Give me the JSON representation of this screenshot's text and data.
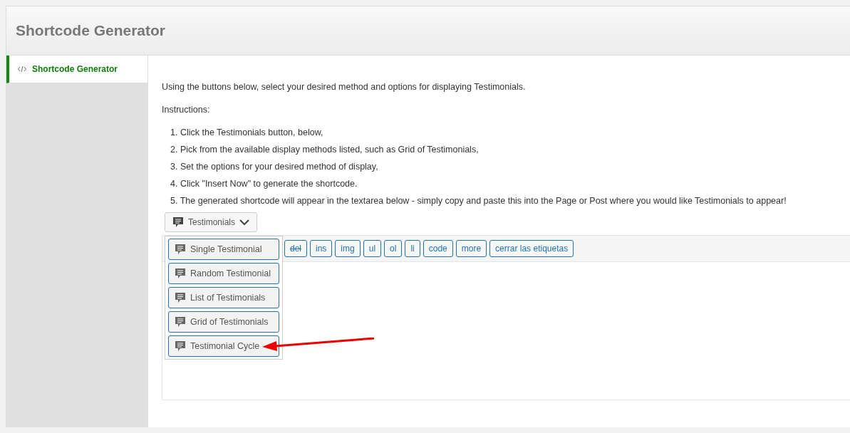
{
  "header": {
    "title": "Shortcode Generator"
  },
  "sidebar": {
    "items": [
      {
        "label": "Shortcode Generator",
        "selected": true
      }
    ]
  },
  "intro": "Using the buttons below, select your desired method and options for displaying Testimonials.",
  "instructions_label": "Instructions:",
  "steps": [
    "1. Click the Testimonials button, below,",
    "2. Pick from the available display methods listed, such as Grid of Testimonials,",
    "3. Set the options for your desired method of display,",
    "4. Click \"Insert Now\" to generate the shortcode.",
    "5. The generated shortcode will appear in the textarea below - simply copy and paste this into the Page or Post where you would like Testimonials to appear!"
  ],
  "dropdown": {
    "label": "Testimonials",
    "expanded": true,
    "items": [
      "Single Testimonial",
      "Random Testimonial",
      "List of Testimonials",
      "Grid of Testimonials",
      "Testimonial Cycle"
    ]
  },
  "toolbar": [
    {
      "label": "del",
      "kind": "strike"
    },
    {
      "label": "ins",
      "kind": "plain"
    },
    {
      "label": "img",
      "kind": "plain"
    },
    {
      "label": "ul",
      "kind": "plain"
    },
    {
      "label": "ol",
      "kind": "plain"
    },
    {
      "label": "li",
      "kind": "plain"
    },
    {
      "label": "code",
      "kind": "plain"
    },
    {
      "label": "more",
      "kind": "plain"
    },
    {
      "label": "cerrar las etiquetas",
      "kind": "plain"
    }
  ]
}
